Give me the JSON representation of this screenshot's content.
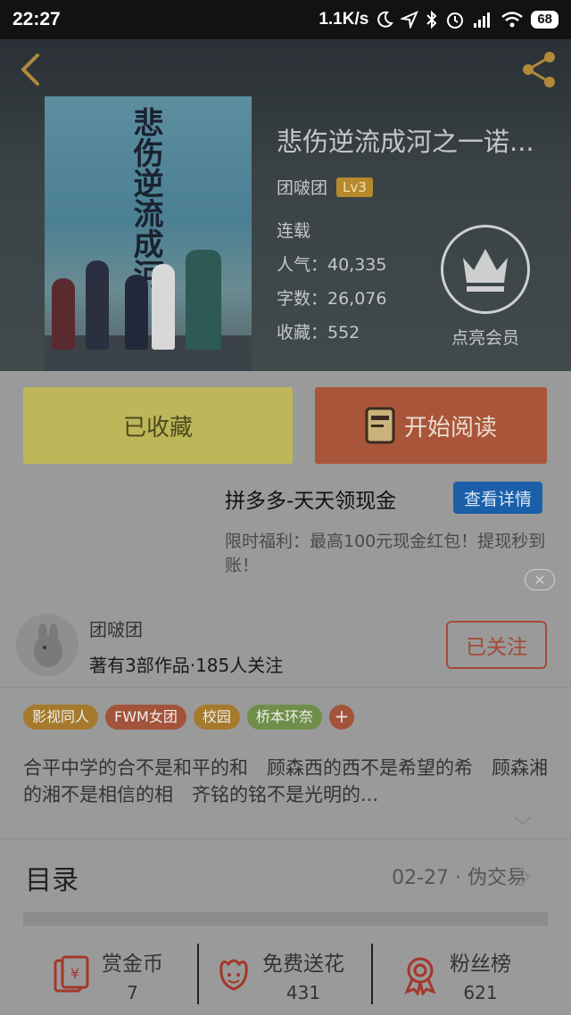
{
  "status_bar": {
    "time": "22:27",
    "network_speed": "1.1K/s",
    "battery": "68"
  },
  "book": {
    "title": "悲伤逆流成河之一诺...",
    "cover_title": "悲伤逆流成河",
    "author": "团啵团",
    "level": "Lv3",
    "status": "连载",
    "popularity": "人气：40,335",
    "word_count": "字数：26,076",
    "favorites": "收藏：552",
    "vip_label": "点亮会员"
  },
  "actions": {
    "collected_label": "已收藏",
    "read_label": "开始阅读"
  },
  "ad": {
    "title": "拼多多-天天领现金",
    "button": "查看详情",
    "description": "限时福利：最高100元现金红包！提现秒到账！",
    "close": "×"
  },
  "author_card": {
    "name": "团啵团",
    "stats": "著有3部作品·185人关注",
    "follow_label": "已关注"
  },
  "tags": [
    {
      "label": "影视同人",
      "color": "#a57a2c"
    },
    {
      "label": "FWM女团",
      "color": "#a3533a"
    },
    {
      "label": "校园",
      "color": "#a57a2c"
    },
    {
      "label": "桥本环奈",
      "color": "#6f8e4a"
    }
  ],
  "tag_add": "+",
  "description": "合平中学的合不是和平的和　顾森西的西不是希望的希　顾森湘的湘不是相信的相　齐铭的铭不是光明的...",
  "toc": {
    "label": "目录",
    "latest": "02-27 · 伪交易"
  },
  "stats": [
    {
      "label": "赏金币",
      "value": "7",
      "icon": "red-envelope-icon"
    },
    {
      "label": "免费送花",
      "value": "431",
      "icon": "flower-icon"
    },
    {
      "label": "粉丝榜",
      "value": "621",
      "icon": "medal-icon"
    }
  ]
}
